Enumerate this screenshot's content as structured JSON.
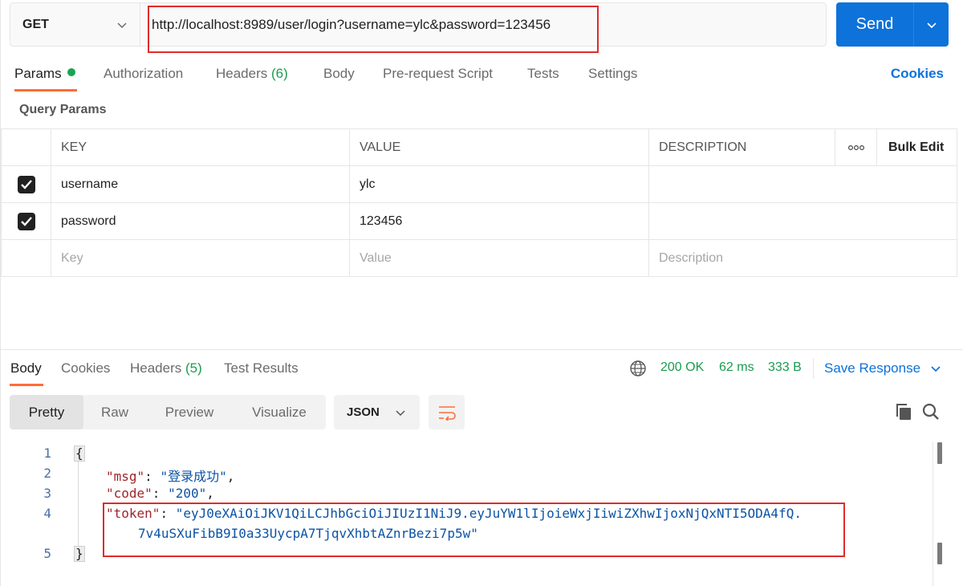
{
  "request": {
    "method": "GET",
    "url": "http://localhost:8989/user/login?username=ylc&password=123456",
    "send_label": "Send"
  },
  "req_tabs": {
    "params": "Params",
    "authorization": "Authorization",
    "headers": "Headers",
    "headers_count": "(6)",
    "body": "Body",
    "prerequest": "Pre-request Script",
    "tests": "Tests",
    "settings": "Settings",
    "cookies": "Cookies"
  },
  "query_params": {
    "title": "Query Params",
    "headers": {
      "key": "KEY",
      "value": "VALUE",
      "description": "DESCRIPTION",
      "bulk_edit": "Bulk Edit"
    },
    "rows": [
      {
        "key": "username",
        "value": "ylc",
        "description": "",
        "checked": true
      },
      {
        "key": "password",
        "value": "123456",
        "description": "",
        "checked": true
      }
    ],
    "placeholder": {
      "key": "Key",
      "value": "Value",
      "description": "Description"
    }
  },
  "response": {
    "tabs": {
      "body": "Body",
      "cookies": "Cookies",
      "headers": "Headers",
      "headers_count": "(5)",
      "test_results": "Test Results"
    },
    "status": "200 OK",
    "time": "62 ms",
    "size": "333 B",
    "save_label": "Save Response",
    "views": [
      "Pretty",
      "Raw",
      "Preview",
      "Visualize"
    ],
    "format": "JSON",
    "lines": {
      "n1": "1",
      "n2": "2",
      "n3": "3",
      "n4": "4",
      "n5": "5",
      "open": "{",
      "close": "}",
      "msg_key": "\"msg\"",
      "msg_val": "\"登录成功\"",
      "code_key": "\"code\"",
      "code_val": "\"200\"",
      "token_key": "\"token\"",
      "token_val_1": "\"eyJ0eXAiOiJKV1QiLCJhbGciOiJIUzI1NiJ9.eyJuYW1lIjoieWxjIiwiZXhwIjoxNjQxNTI5ODA4fQ.",
      "token_val_2": "7v4uSXuFibB9I0a33UycpA7TjqvXhbtAZnrBezi7p5w\""
    }
  },
  "colors": {
    "accent": "#ff6c37",
    "primary": "#0d72d9",
    "success": "#1a9c4e",
    "highlight": "#e02b2b"
  }
}
